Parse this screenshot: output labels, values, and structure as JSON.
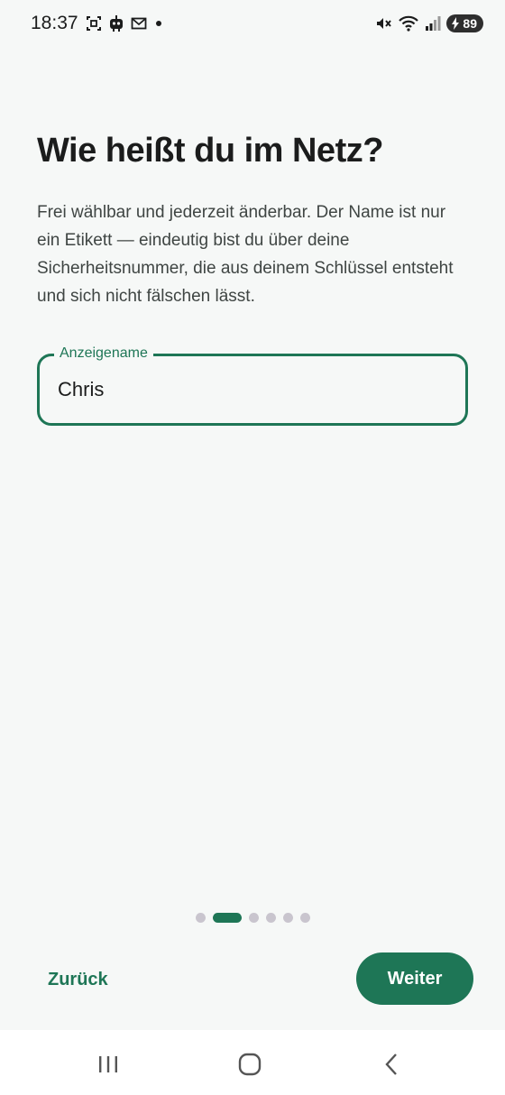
{
  "status_bar": {
    "time": "18:37",
    "battery_level": "89",
    "icons": [
      "screenshot-icon",
      "bot-icon",
      "mail-icon",
      "notification-dot-icon",
      "mute-icon",
      "wifi-icon",
      "signal-icon",
      "battery-charging-icon"
    ]
  },
  "onboarding": {
    "title": "Wie heißt du im Netz?",
    "description": "Frei wählbar und jederzeit änderbar. Der Name ist nur ein Etikett — eindeutig bist du über deine Sicherheitsnummer, die aus deinem Schlüssel entsteht und sich nicht fälschen lässt.",
    "field": {
      "label": "Anzeigename",
      "value": "Chris"
    },
    "pager": {
      "total_steps": 6,
      "current_step": 2
    }
  },
  "actions": {
    "back_label": "Zurück",
    "next_label": "Weiter"
  },
  "nav_bar": {
    "icons": [
      "recent-apps-icon",
      "home-icon",
      "back-icon"
    ]
  },
  "colors": {
    "accent": "#1e7656",
    "background": "#f6f8f7",
    "inactive_dot": "#c9c5ce"
  }
}
